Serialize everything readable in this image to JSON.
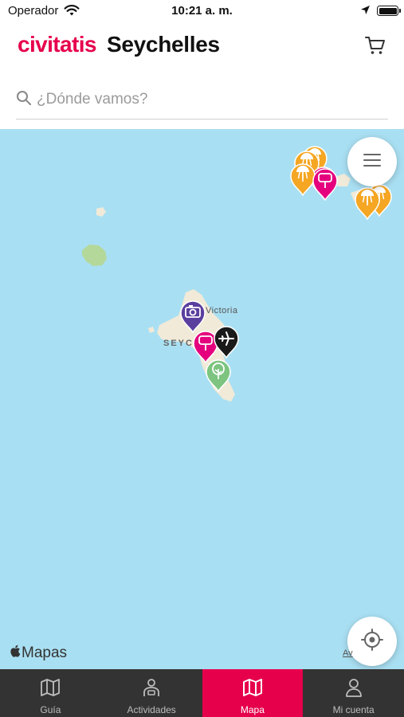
{
  "status_bar": {
    "carrier": "Operador",
    "time": "10:21 a. m."
  },
  "header": {
    "brand": "civitatis",
    "destination": "Seychelles",
    "cart_icon": "cart-icon"
  },
  "search": {
    "placeholder": "¿Dónde vamos?",
    "value": "",
    "icon": "search-icon"
  },
  "map": {
    "labels": {
      "capital": "Victoria",
      "country": "SEYC"
    },
    "pins": [
      {
        "category": "beach",
        "color": "#f5a623"
      },
      {
        "category": "beach",
        "color": "#f5a623"
      },
      {
        "category": "sightseeing",
        "color": "#e5007e"
      },
      {
        "category": "beach",
        "color": "#f5a623"
      },
      {
        "category": "sightseeing",
        "color": "#e5007e"
      },
      {
        "category": "beach",
        "color": "#f5a623"
      },
      {
        "category": "beach",
        "color": "#f5a623"
      },
      {
        "category": "photo",
        "color": "#5b3f9e"
      },
      {
        "category": "sightseeing",
        "color": "#e5007e"
      },
      {
        "category": "airport",
        "color": "#1a1a1a"
      },
      {
        "category": "nature",
        "color": "#7cc47f"
      }
    ],
    "menu_icon": "hamburger-icon",
    "locate_icon": "crosshair-icon",
    "attribution": "Mapas",
    "legal": "Av"
  },
  "tabbar": {
    "active": "Mapa",
    "tabs": [
      {
        "label": "Guía",
        "icon": "guide-map-icon"
      },
      {
        "label": "Actividades",
        "icon": "activities-person-icon"
      },
      {
        "label": "Mapa",
        "icon": "map-icon"
      },
      {
        "label": "Mi cuenta",
        "icon": "user-icon"
      }
    ]
  },
  "colors": {
    "brand": "#e6004c",
    "map_water": "#a9dff2",
    "tabbar_bg": "#333333"
  }
}
